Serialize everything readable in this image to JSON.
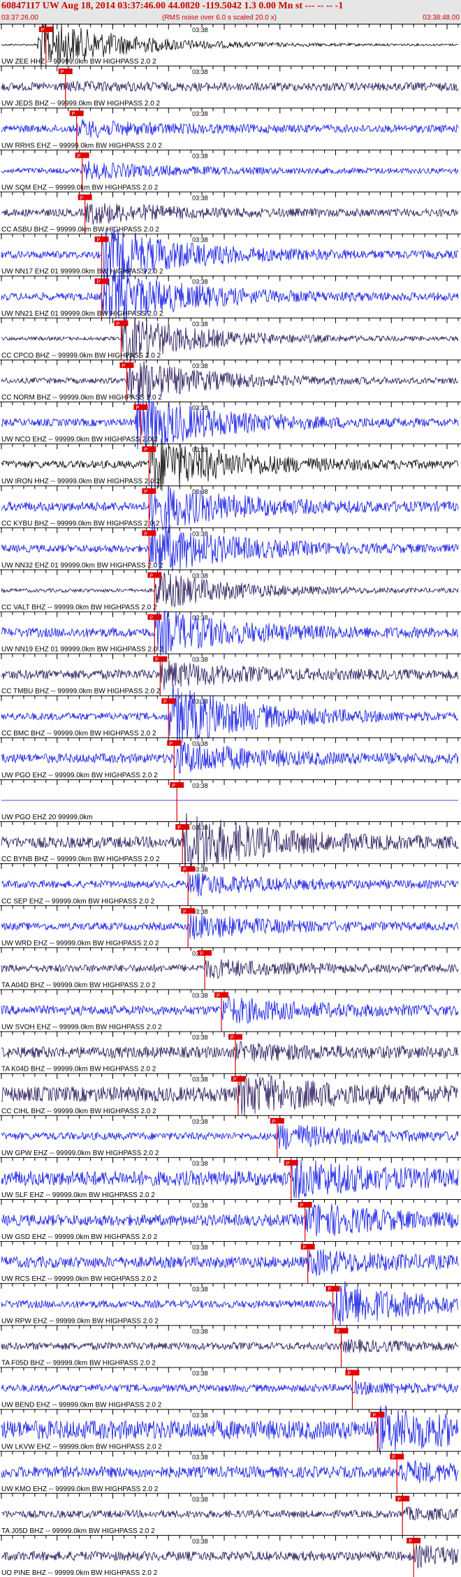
{
  "header": {
    "title": "60847117 UW Aug 18, 2014 03:37:46.00   44.0820 -119.5042  1.3 0.00 Mn st --- -- --  -1",
    "start_time": "03:37:26.00",
    "note": "(RMS noise over 6.0 s scaled 20.0 x)",
    "end_time": "03:38:48.00"
  },
  "chart_data": {
    "type": "line",
    "x_unit": "seconds after 03:37:26.00",
    "xlim": [
      0,
      82
    ],
    "minute_label": "03:38",
    "minute_mark_s": 34,
    "pick_label": "P",
    "colors": {
      "dark": "#221155",
      "blue": "#0b13e6",
      "black": "#000000",
      "pick": "#e00000"
    },
    "traces": [
      {
        "label": "UW ZEE HHZ -- 99999.0km BW  HIGHPASS  2.0  2",
        "color": "black",
        "pick_s": 8.0,
        "onset_s": 6.5,
        "amp": 1.5,
        "noise": 0.05
      },
      {
        "label": "UW JEDS BHZ -- 99999.0km BW  HIGHPASS  2.0  2",
        "color": "dark",
        "pick_s": 11.5,
        "onset_s": 11.5,
        "amp": 0.1,
        "noise": 0.22
      },
      {
        "label": "UW RRHS EHZ -- 99999.0km BW  HIGHPASS  2.0  2",
        "color": "blue",
        "pick_s": 13.5,
        "onset_s": 13.5,
        "amp": 0.35,
        "noise": 0.2
      },
      {
        "label": "UW SQM EHZ -- 99999.0km BW  HIGHPASS  2.0  2",
        "color": "blue",
        "pick_s": 14.5,
        "onset_s": 14.5,
        "amp": 0.4,
        "noise": 0.15
      },
      {
        "label": "CC ASBU BHZ -- 99999.0km BW  HIGHPASS  2.0  2",
        "color": "dark",
        "pick_s": 15.0,
        "onset_s": 15.0,
        "amp": 0.5,
        "noise": 0.2
      },
      {
        "label": "UW NN17 EHZ 01 99999.0km BW  HIGHPASS  2.0  2",
        "color": "blue",
        "pick_s": 18.0,
        "onset_s": 18.0,
        "amp": 1.5,
        "noise": 0.2
      },
      {
        "label": "UW NN21 EHZ 01 99999.0km BW  HIGHPASS  2.0  2",
        "color": "blue",
        "pick_s": 18.0,
        "onset_s": 18.0,
        "amp": 1.5,
        "noise": 0.2
      },
      {
        "label": "CC CPCO BHZ -- 99999.0km BW  HIGHPASS  2.0  2",
        "color": "dark",
        "pick_s": 21.5,
        "onset_s": 21.5,
        "amp": 1.3,
        "noise": 0.1
      },
      {
        "label": "CC NORM BHZ -- 99999.0km BW  HIGHPASS  2.0  2",
        "color": "dark",
        "pick_s": 22.5,
        "onset_s": 22.5,
        "amp": 1.1,
        "noise": 0.15
      },
      {
        "label": "UW NCO EHZ -- 99999.0km BW  HIGHPASS  2.0  2",
        "color": "blue",
        "pick_s": 25.0,
        "onset_s": 24.0,
        "amp": 1.5,
        "noise": 0.2
      },
      {
        "label": "UW IRON HHZ -- 99999.0km BW  HIGHPASS  2.0  2",
        "color": "black",
        "pick_s": 26.5,
        "onset_s": 26.5,
        "amp": 1.5,
        "noise": 0.2
      },
      {
        "label": "CC KYBU BHZ -- 99999.0km BW  HIGHPASS  2.0  2",
        "color": "blue",
        "pick_s": 26.5,
        "onset_s": 26.5,
        "amp": 1.2,
        "noise": 0.25
      },
      {
        "label": "UW NN32 EHZ 01 99999.0km BW  HIGHPASS  2.0  2",
        "color": "blue",
        "pick_s": 26.5,
        "onset_s": 26.5,
        "amp": 1.4,
        "noise": 0.2
      },
      {
        "label": "CC VALT BHZ -- 99999.0km BW  HIGHPASS  2.0  2",
        "color": "dark",
        "pick_s": 27.5,
        "onset_s": 27.5,
        "amp": 1.0,
        "noise": 0.1
      },
      {
        "label": "UW NN19 EHZ 01 99999.0km BW  HIGHPASS  2.0  2",
        "color": "blue",
        "pick_s": 27.5,
        "onset_s": 27.5,
        "amp": 1.1,
        "noise": 0.25
      },
      {
        "label": "CC TMBU BHZ -- 99999.0km BW  HIGHPASS  2.0  2",
        "color": "dark",
        "pick_s": 28.5,
        "onset_s": 28.5,
        "amp": 0.6,
        "noise": 0.25
      },
      {
        "label": "CC BMC BHZ -- 99999.0km BW  HIGHPASS  2.0  2",
        "color": "blue",
        "pick_s": 30.0,
        "onset_s": 30.0,
        "amp": 1.6,
        "noise": 0.2
      },
      {
        "label": "UW PGO EHZ -- 99999.0km BW  HIGHPASS  2.0  2",
        "color": "blue",
        "pick_s": 31.0,
        "onset_s": 31.0,
        "amp": 0.8,
        "noise": 0.25
      },
      {
        "label": "UW PGO EHZ 20 99999.0km",
        "color": "blue",
        "pick_s": 31.5,
        "onset_s": 31.5,
        "amp": 0.0,
        "noise": 0.0
      },
      {
        "label": "CC BYNB BHZ -- 99999.0km BW  HIGHPASS  2.0  2",
        "color": "dark",
        "pick_s": 32.5,
        "onset_s": 32.5,
        "amp": 1.5,
        "noise": 0.3
      },
      {
        "label": "CC SEP EHZ -- 99999.0km BW  HIGHPASS  2.0  2",
        "color": "blue",
        "pick_s": 33.5,
        "onset_s": 33.5,
        "amp": 0.5,
        "noise": 0.2
      },
      {
        "label": "UW WRD EHZ -- 99999.0km BW  HIGHPASS  2.0  2",
        "color": "blue",
        "pick_s": 33.5,
        "onset_s": 33.5,
        "amp": 0.6,
        "noise": 0.2
      },
      {
        "label": "TA A04D BHZ -- 99999.0km BW  HIGHPASS  2.0  2",
        "color": "dark",
        "pick_s": 36.5,
        "onset_s": 36.5,
        "amp": 0.4,
        "noise": 0.2
      },
      {
        "label": "UW SVOH EHZ -- 99999.0km BW  HIGHPASS  2.0  2",
        "color": "blue",
        "pick_s": 39.5,
        "onset_s": 39.5,
        "amp": 0.6,
        "noise": 0.25
      },
      {
        "label": "TA K04D BHZ -- 99999.0km BW  HIGHPASS  2.0  2",
        "color": "dark",
        "pick_s": 42.0,
        "onset_s": 42.0,
        "amp": 0.3,
        "noise": 0.3
      },
      {
        "label": "CC CIHL BHZ -- 99999.0km BW  HIGHPASS  2.0  2",
        "color": "dark",
        "pick_s": 42.5,
        "onset_s": 42.5,
        "amp": 0.9,
        "noise": 0.4
      },
      {
        "label": "UW GPW EHZ -- 99999.0km BW  HIGHPASS  2.0  2",
        "color": "blue",
        "pick_s": 49.5,
        "onset_s": 49.5,
        "amp": 0.6,
        "noise": 0.2
      },
      {
        "label": "UW SLF EHZ -- 99999.0km BW  HIGHPASS  2.0  2",
        "color": "blue",
        "pick_s": 52.0,
        "onset_s": 52.0,
        "amp": 0.8,
        "noise": 0.4
      },
      {
        "label": "UW GSD EHZ -- 99999.0km BW  HIGHPASS  2.0  2",
        "color": "blue",
        "pick_s": 54.5,
        "onset_s": 54.5,
        "amp": 0.8,
        "noise": 0.3
      },
      {
        "label": "UW RCS EHZ -- 99999.0km BW  HIGHPASS  2.0  2",
        "color": "blue",
        "pick_s": 55.0,
        "onset_s": 55.0,
        "amp": 0.5,
        "noise": 0.3
      },
      {
        "label": "UW RPW EHZ -- 99999.0km BW  HIGHPASS  2.0  2",
        "color": "blue",
        "pick_s": 59.5,
        "onset_s": 59.5,
        "amp": 1.2,
        "noise": 0.2
      },
      {
        "label": "TA F05D BHZ -- 99999.0km BW  HIGHPASS  2.0  2",
        "color": "dark",
        "pick_s": 61.0,
        "onset_s": 61.0,
        "amp": 0.2,
        "noise": 0.2
      },
      {
        "label": "UW BEND EHZ -- 99999.0km BW  HIGHPASS  2.0  2",
        "color": "blue",
        "pick_s": 63.0,
        "onset_s": 63.0,
        "amp": 0.2,
        "noise": 0.2
      },
      {
        "label": "UW LKVW EHZ -- 99999.0km BW  HIGHPASS  2.0  2",
        "color": "blue",
        "pick_s": 67.5,
        "onset_s": 67.5,
        "amp": 0.9,
        "noise": 0.5
      },
      {
        "label": "UW KMO EHZ -- 99999.0km BW  HIGHPASS  2.0  2",
        "color": "blue",
        "pick_s": 71.0,
        "onset_s": 71.0,
        "amp": 0.4,
        "noise": 0.3
      },
      {
        "label": "TA J05D BHZ -- 99999.0km BW  HIGHPASS  2.0  2",
        "color": "dark",
        "pick_s": 72.0,
        "onset_s": 72.0,
        "amp": 0.2,
        "noise": 0.2
      },
      {
        "label": "UO PINE BHZ -- 99999.0km BW  HIGHPASS  2.0  2",
        "color": "dark",
        "pick_s": 74.0,
        "onset_s": 74.0,
        "amp": 0.4,
        "noise": 0.25
      }
    ]
  }
}
